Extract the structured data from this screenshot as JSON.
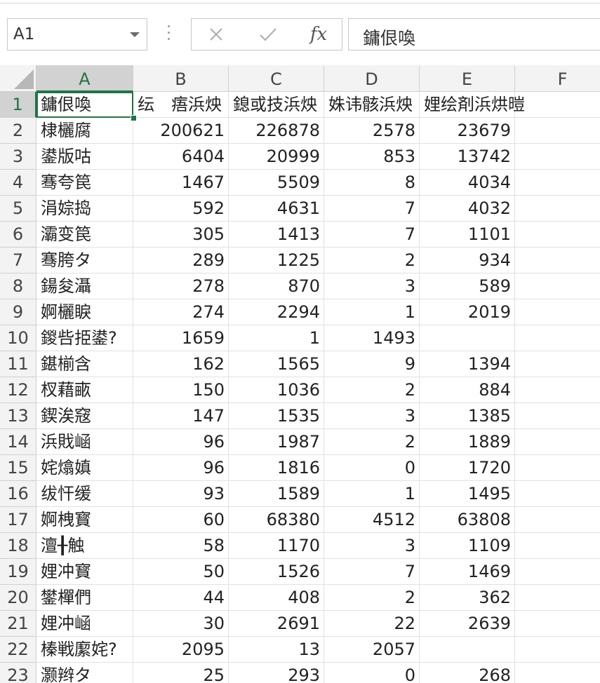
{
  "name_box": {
    "value": "A1"
  },
  "formula_bar": {
    "value": "鏞佷喚",
    "fx_label": "fx"
  },
  "columns": [
    "A",
    "B",
    "C",
    "D",
    "E",
    "F"
  ],
  "header_row": [
    "鏞佷喚",
    "纭　痦浜炴",
    "鎴或技浜炴",
    "姝讳骸浜炴",
    "娌绘剤浜烘暟",
    ""
  ],
  "rows": [
    [
      "棣欐腐",
      "200621",
      "226878",
      "2578",
      "23679",
      ""
    ],
    [
      "鍙版咕",
      "6404",
      "20999",
      "853",
      "13742",
      ""
    ],
    [
      "骞夸笢",
      "1467",
      "5509",
      "8",
      "4034",
      ""
    ],
    [
      "涓婃捣",
      "592",
      "4631",
      "7",
      "4032",
      ""
    ],
    [
      "灞变笢",
      "305",
      "1413",
      "7",
      "1101",
      ""
    ],
    [
      "骞胯タ",
      "289",
      "1225",
      "2",
      "934",
      ""
    ],
    [
      "鍚夋灄",
      "278",
      "870",
      "3",
      "589",
      ""
    ],
    [
      "婀欐睙",
      "274",
      "2294",
      "1",
      "2019",
      ""
    ],
    [
      "鍐呰挋鍙?",
      "1659",
      "1",
      "1493",
      "",
      ""
    ],
    [
      "鍖椾含",
      "162",
      "1565",
      "9",
      "1394",
      ""
    ],
    [
      "杈藉畞",
      "150",
      "1036",
      "2",
      "884",
      ""
    ],
    [
      "鍥涘窛",
      "147",
      "1535",
      "3",
      "1385",
      ""
    ],
    [
      "浜戝崡",
      "96",
      "1987",
      "2",
      "1889",
      ""
    ],
    [
      "姹熻嫃",
      "96",
      "1816",
      "0",
      "1720",
      ""
    ],
    [
      "绂忓缓",
      "93",
      "1589",
      "1",
      "1495",
      ""
    ],
    [
      "婀栧寳",
      "60",
      "68380",
      "4512",
      "63808",
      ""
    ],
    [
      "澶╂触",
      "58",
      "1170",
      "3",
      "1109",
      ""
    ],
    [
      "娌冲寳",
      "50",
      "1526",
      "7",
      "1469",
      ""
    ],
    [
      "鐢樿們",
      "44",
      "408",
      "2",
      "362",
      ""
    ],
    [
      "娌冲崡",
      "30",
      "2691",
      "22",
      "2639",
      ""
    ],
    [
      "榛戦緳姹?",
      "2095",
      "13",
      "2057",
      "",
      ""
    ],
    [
      "灏辫タ",
      "25",
      "293",
      "0",
      "268",
      ""
    ]
  ],
  "selected_cell": "A1"
}
